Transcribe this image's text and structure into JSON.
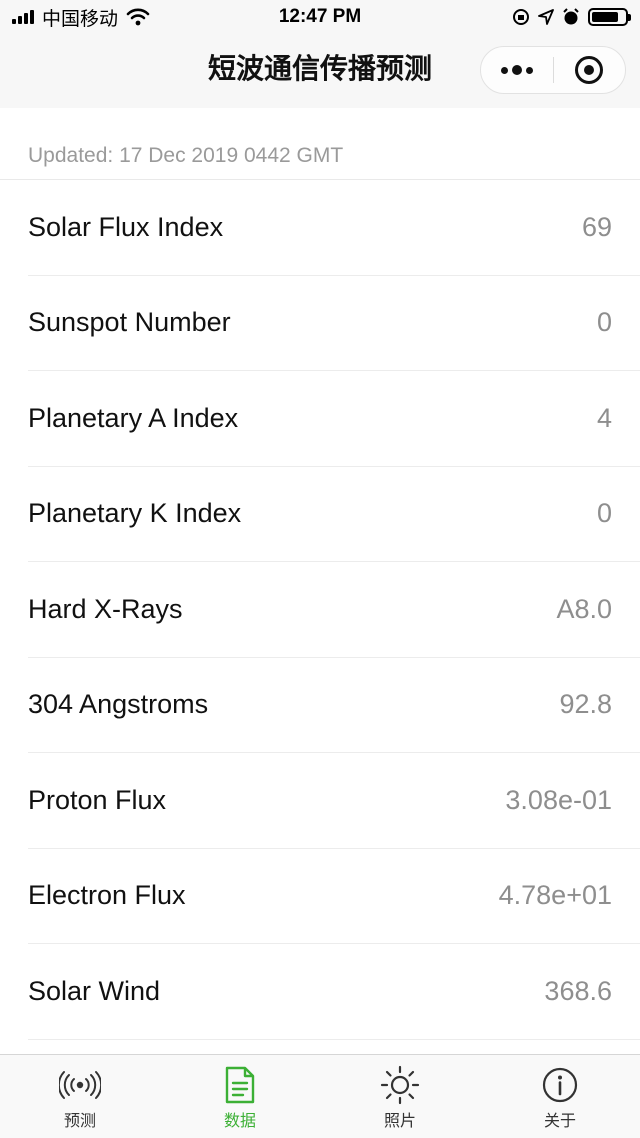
{
  "status_bar": {
    "carrier": "中国移动",
    "time": "12:47 PM"
  },
  "nav": {
    "title": "短波通信传播预测"
  },
  "updated_text": "Updated: 17 Dec 2019 0442 GMT",
  "rows": [
    {
      "label": "Solar Flux Index",
      "value": "69"
    },
    {
      "label": "Sunspot Number",
      "value": "0"
    },
    {
      "label": "Planetary A Index",
      "value": "4"
    },
    {
      "label": "Planetary K Index",
      "value": "0"
    },
    {
      "label": "Hard X-Rays",
      "value": "A8.0"
    },
    {
      "label": "304 Angstroms",
      "value": "92.8"
    },
    {
      "label": "Proton Flux",
      "value": "3.08e-01"
    },
    {
      "label": "Electron Flux",
      "value": "4.78e+01"
    },
    {
      "label": "Solar Wind",
      "value": "368.6"
    }
  ],
  "tabs": [
    {
      "label": "预测",
      "icon": "radio-waves-icon",
      "active": false
    },
    {
      "label": "数据",
      "icon": "document-icon",
      "active": true
    },
    {
      "label": "照片",
      "icon": "sun-icon",
      "active": false
    },
    {
      "label": "关于",
      "icon": "info-icon",
      "active": false
    }
  ],
  "colors": {
    "accent": "#3cb035",
    "value_text": "#8e8e8e",
    "secondary_text": "#9a9a9a"
  }
}
